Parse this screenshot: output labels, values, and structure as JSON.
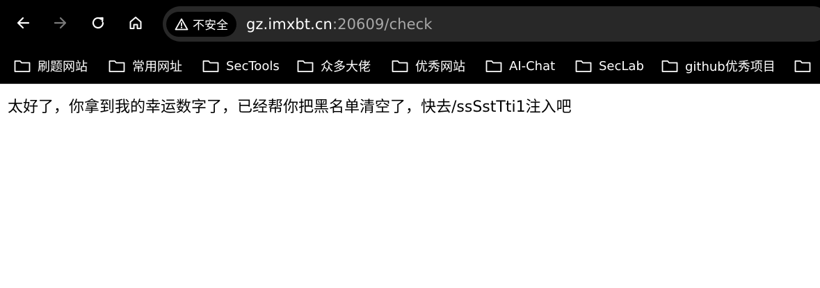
{
  "browser": {
    "address_bar": {
      "security_label": "不安全",
      "url_host": "gz.imxbt.cn",
      "url_rest": ":20609/check"
    },
    "nav_icons": [
      "back-arrow-icon",
      "forward-arrow-icon",
      "reload-icon",
      "home-icon"
    ],
    "bookmarks": [
      {
        "label": "刷题网站",
        "icon": "folder-icon"
      },
      {
        "label": "常用网址",
        "icon": "folder-icon"
      },
      {
        "label": "SecTools",
        "icon": "folder-icon"
      },
      {
        "label": "众多大佬",
        "icon": "folder-icon"
      },
      {
        "label": "优秀网站",
        "icon": "folder-icon"
      },
      {
        "label": "AI-Chat",
        "icon": "folder-icon"
      },
      {
        "label": "SecLab",
        "icon": "folder-icon"
      },
      {
        "label": "github优秀项目",
        "icon": "folder-icon"
      },
      {
        "label": "",
        "icon": "folder-icon"
      }
    ]
  },
  "page": {
    "message": "太好了，你拿到我的幸运数字了，已经帮你把黑名单清空了，快去/ssSstTti1注入吧"
  },
  "colors": {
    "chrome_bg": "#000000",
    "omnibox_bg": "#282828",
    "url_path": "#a8a8a8",
    "page_bg": "#ffffff"
  }
}
